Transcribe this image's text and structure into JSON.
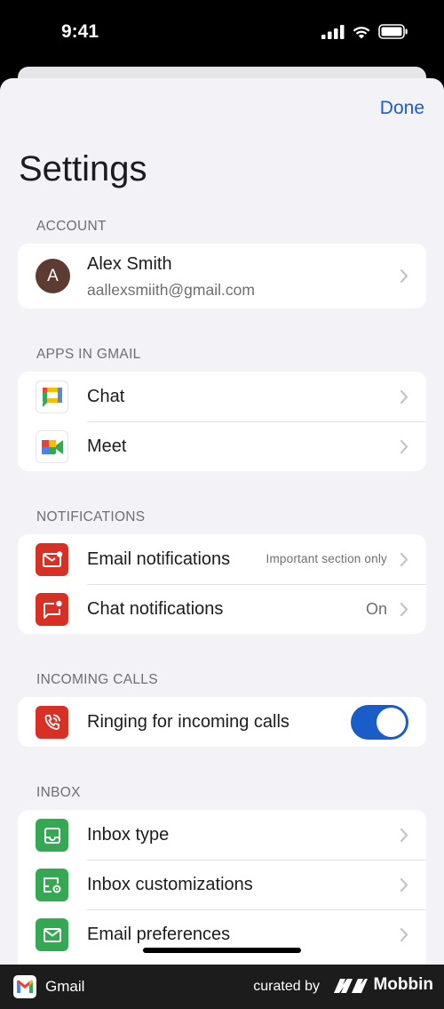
{
  "status_bar": {
    "time": "9:41"
  },
  "header": {
    "done_label": "Done",
    "title": "Settings"
  },
  "account": {
    "section_title": "ACCOUNT",
    "avatar_initial": "A",
    "name": "Alex Smith",
    "email": "aallexsmiith@gmail.com"
  },
  "apps": {
    "section_title": "APPS IN GMAIL",
    "items": [
      {
        "label": "Chat",
        "icon": "google-chat-icon"
      },
      {
        "label": "Meet",
        "icon": "google-meet-icon"
      }
    ]
  },
  "notifications": {
    "section_title": "NOTIFICATIONS",
    "items": [
      {
        "label": "Email notifications",
        "value": "Important section only",
        "icon": "mail-notification-icon"
      },
      {
        "label": "Chat notifications",
        "value": "On",
        "icon": "chat-notification-icon"
      }
    ]
  },
  "incoming_calls": {
    "section_title": "INCOMING CALLS",
    "label": "Ringing for incoming calls",
    "toggle_on": true,
    "icon": "ringing-phone-icon"
  },
  "inbox": {
    "section_title": "INBOX",
    "items": [
      {
        "label": "Inbox type",
        "icon": "inbox-tray-icon"
      },
      {
        "label": "Inbox customizations",
        "icon": "inbox-settings-icon"
      },
      {
        "label": "Email preferences",
        "icon": "envelope-icon"
      }
    ]
  },
  "footer": {
    "app_name": "Gmail",
    "curated_by": "curated by",
    "brand": "Mobbin"
  },
  "colors": {
    "accent": "#1a5dc8",
    "red_icon": "#d93025",
    "green_icon": "#34a853",
    "background": "#f2f2f7"
  }
}
